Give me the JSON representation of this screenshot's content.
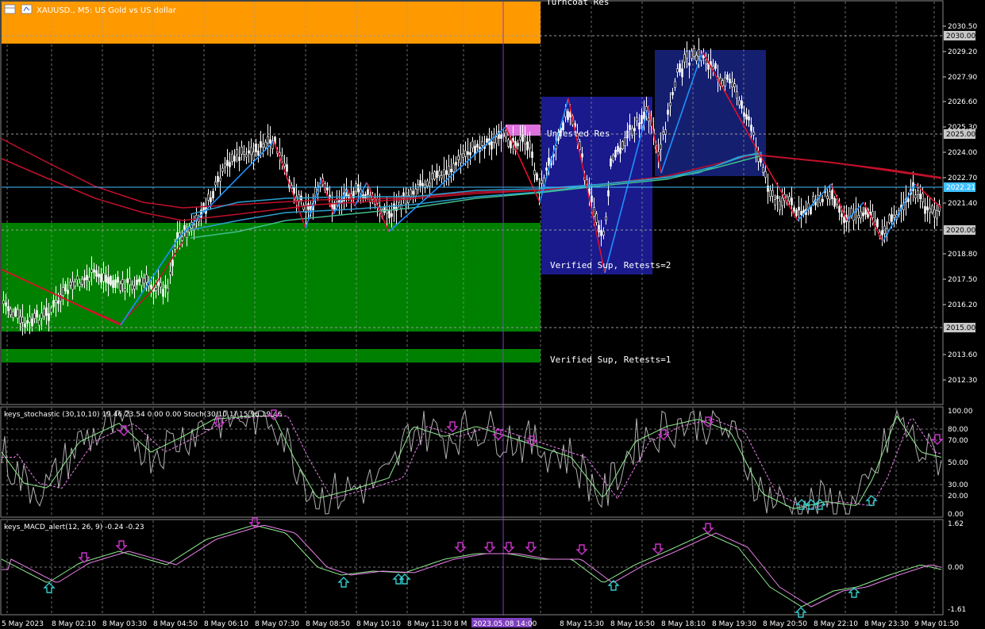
{
  "window": {
    "title": "XAUUSD., M5: US Gold vs US dollar",
    "icons": [
      "chart-window-icon",
      "chart-type-icon"
    ]
  },
  "colors": {
    "background": "#000000",
    "grid": "#9a9a9a",
    "supply_zone_top": "#ff9900",
    "demand_zone": "#008000",
    "untested_res": "#e070e0",
    "box_blue": "#1a1a8c",
    "box_navy": "#151f70",
    "zigzag_up": "#1e90ff",
    "zigzag_down": "#e0102a",
    "ma_red": "#c0102a",
    "ma_cyan": "#2aa0d0",
    "ma_green": "#3fbf8f",
    "bid_line": "#40c0ff",
    "vline": "#8040c0",
    "stoch_main": "#b0b0b0",
    "stoch_signal": "#90ee90",
    "stoch_dash": "#ee82ee",
    "macd_main": "#90ee90",
    "macd_signal": "#ee82ee",
    "arrow_down": "#cc33cc",
    "arrow_up": "#33cccc"
  },
  "main_chart": {
    "price_axis": [
      "2030.50",
      "2029.20",
      "2027.90",
      "2026.60",
      "2025.30",
      "2024.00",
      "2022.70",
      "2021.40",
      "2018.80",
      "2017.50",
      "2016.20",
      "2013.60",
      "2012.30"
    ],
    "price_tags": [
      {
        "label": "2030.00",
        "style": "dark"
      },
      {
        "label": "2025.00",
        "style": "dark"
      },
      {
        "label": "2022.21",
        "style": "bid"
      },
      {
        "label": "2020.00",
        "style": "dark"
      },
      {
        "label": "2015.00",
        "style": "dark"
      }
    ],
    "zone_labels": {
      "turncoat": "Turncoat Res",
      "untested": "Untested Res",
      "verified_sup_2": "Verified Sup, Retests=2",
      "verified_sup_1": "Verified Sup, Retests=1"
    }
  },
  "stochastic": {
    "caption": "keys_stochastic (30,10,10) 19.46 23.54 0.00 0.00 Stoch(30,10,1) 15.96 19.46",
    "axis": [
      "100.00",
      "80.00",
      "70.00",
      "50.00",
      "30.00",
      "20.00",
      "0.00"
    ]
  },
  "macd": {
    "caption": "keys_MACD_alert(12, 26, 9) -0.24 -0.23",
    "axis": [
      "1.62",
      "0.00",
      "-1.61"
    ]
  },
  "time_axis": [
    "5 May 2023",
    "8 May 02:10",
    "8 May 03:30",
    "8 May 04:50",
    "8 May 06:10",
    "8 May 07:30",
    "8 May 08:50",
    "8 May 10:10",
    "8 May 11:30",
    "8 M",
    "14:10",
    "8 May 15:30",
    "8 May 16:50",
    "8 May 18:10",
    "8 May 19:30",
    "8 May 20:50",
    "8 May 22:10",
    "8 May 23:30",
    "9 May 01:50"
  ],
  "crosshair_time": "2023.05.08 14:00"
}
